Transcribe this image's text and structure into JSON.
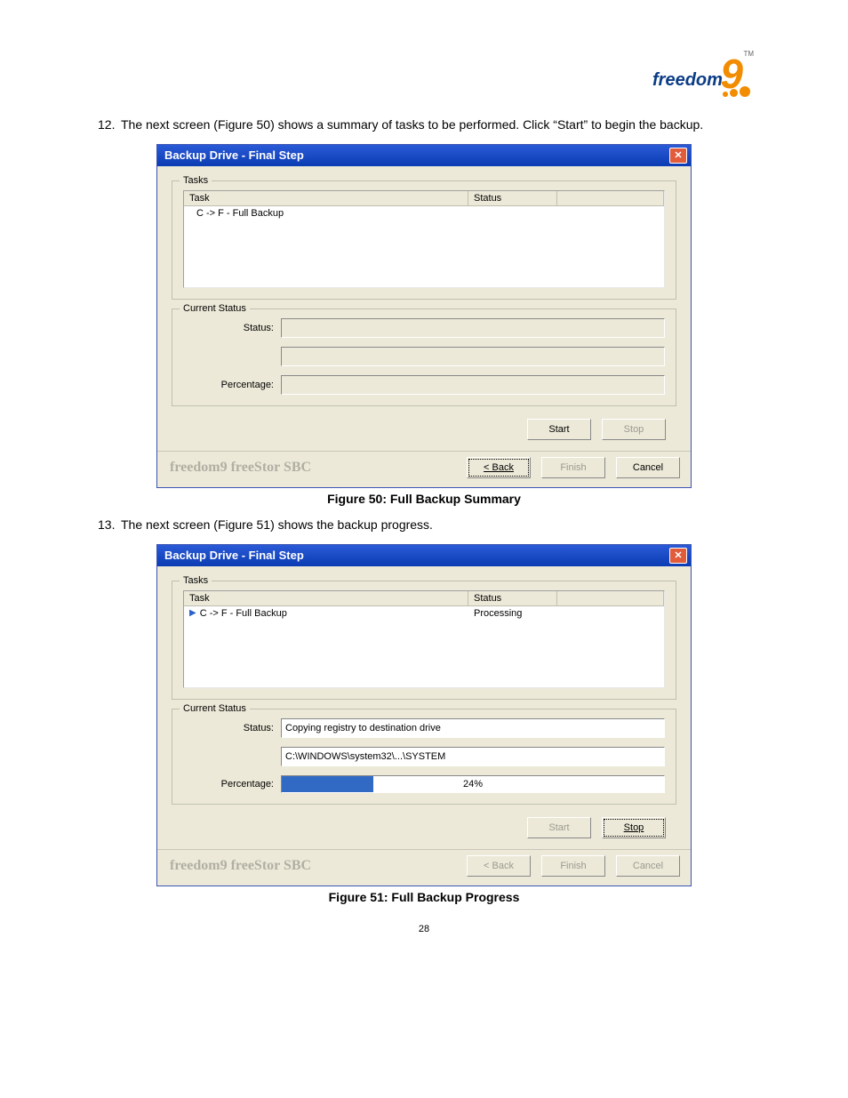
{
  "logo": {
    "text": "freedom",
    "nine": "9",
    "tm": "TM"
  },
  "para12": {
    "num": "12.",
    "text": "The next screen (Figure 50) shows a summary of tasks to be performed. Click “Start” to begin the backup."
  },
  "para13": {
    "num": "13.",
    "text": "The next screen (Figure 51) shows the backup progress."
  },
  "caption50": "Figure 50: Full Backup Summary",
  "caption51": "Figure 51: Full Backup Progress",
  "page_number": "28",
  "dlg50": {
    "title": "Backup Drive - Final Step",
    "group_tasks": "Tasks",
    "group_status": "Current Status",
    "col_task": "Task",
    "col_status": "Status",
    "task_row": {
      "task": "C -> F - Full Backup",
      "status": ""
    },
    "status_label": "Status:",
    "status_value1": "",
    "status_value2": "",
    "percentage_label": "Percentage:",
    "percentage_value": "",
    "progress_pct": 0,
    "buttons": {
      "start": "Start",
      "stop": "Stop",
      "back": "< Back",
      "finish": "Finish",
      "cancel": "Cancel"
    },
    "brand": "freedom9 freeStor SBC"
  },
  "dlg51": {
    "title": "Backup Drive - Final Step",
    "group_tasks": "Tasks",
    "group_status": "Current Status",
    "col_task": "Task",
    "col_status": "Status",
    "task_row": {
      "task": "C -> F - Full Backup",
      "status": "Processing"
    },
    "status_label": "Status:",
    "status_value1": "Copying registry to destination drive",
    "status_value2": "C:\\WINDOWS\\system32\\...\\SYSTEM",
    "percentage_label": "Percentage:",
    "percentage_value": "24%",
    "progress_pct": 24,
    "buttons": {
      "start": "Start",
      "stop": "Stop",
      "back": "< Back",
      "finish": "Finish",
      "cancel": "Cancel"
    },
    "brand": "freedom9 freeStor SBC"
  }
}
